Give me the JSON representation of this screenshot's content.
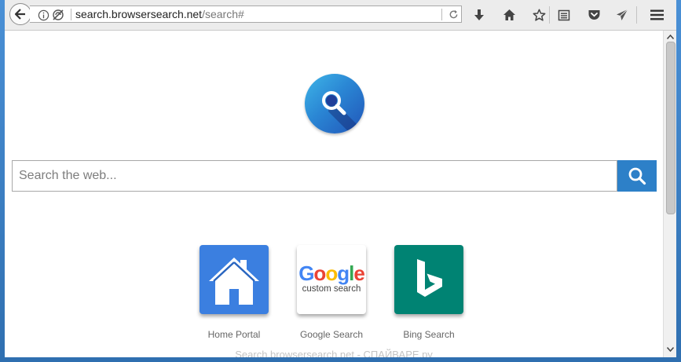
{
  "browser": {
    "url": {
      "host": "search.browsersearch.net",
      "path": "/search#"
    }
  },
  "toolbar_icons": [
    "download-icon",
    "home-icon",
    "bookmark-star-icon",
    "reading-list-icon",
    "pocket-icon",
    "send-icon",
    "hamburger-menu-icon"
  ],
  "page": {
    "search": {
      "placeholder": "Search the web..."
    },
    "tiles": [
      {
        "label": "Home Portal"
      },
      {
        "label": "Google Search",
        "logo_word": "Google",
        "logo_sub": "custom search"
      },
      {
        "label": "Bing Search"
      }
    ],
    "watermark": "Search.browsersearch.net - СПАЙВАРЕ.ру"
  },
  "colors": {
    "accent": "#2d80c8",
    "home_tile": "#3b7fe0",
    "bing_tile": "#008373"
  }
}
